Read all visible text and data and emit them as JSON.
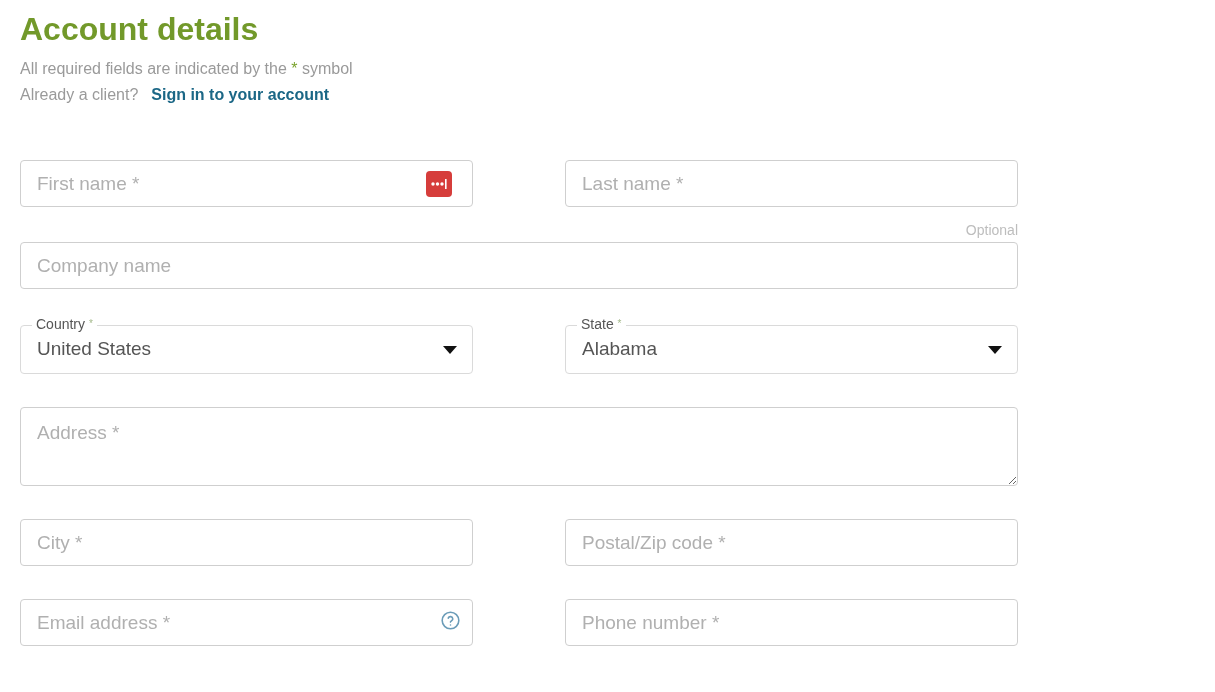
{
  "heading": "Account details",
  "intro": {
    "before": "All required fields are indicated by the",
    "mark": "*",
    "after": "symbol"
  },
  "sign_in": {
    "prompt": "Already a client?",
    "link": "Sign in to your account"
  },
  "rows": [
    {
      "fields": [
        {
          "kind": "text",
          "placeholder": "First name *",
          "autofill": true
        },
        {
          "kind": "text",
          "placeholder": "Last name *"
        }
      ]
    },
    {
      "fields": [
        {
          "kind": "text",
          "placeholder": "Company name",
          "hint": "Optional"
        }
      ]
    },
    {
      "fields": [
        {
          "kind": "select",
          "label": "Country",
          "required_mark": "*",
          "value": "United States"
        },
        {
          "kind": "select",
          "label": "State",
          "required_mark": "*",
          "value": "Alabama"
        }
      ]
    },
    {
      "fields": [
        {
          "kind": "textarea",
          "placeholder": "Address *"
        }
      ]
    },
    {
      "fields": [
        {
          "kind": "text",
          "placeholder": "City *"
        },
        {
          "kind": "text",
          "placeholder": "Postal/Zip code *"
        }
      ]
    },
    {
      "fields": [
        {
          "kind": "text",
          "placeholder": "Email address *",
          "help": true
        },
        {
          "kind": "text",
          "placeholder": "Phone number *"
        }
      ]
    }
  ]
}
